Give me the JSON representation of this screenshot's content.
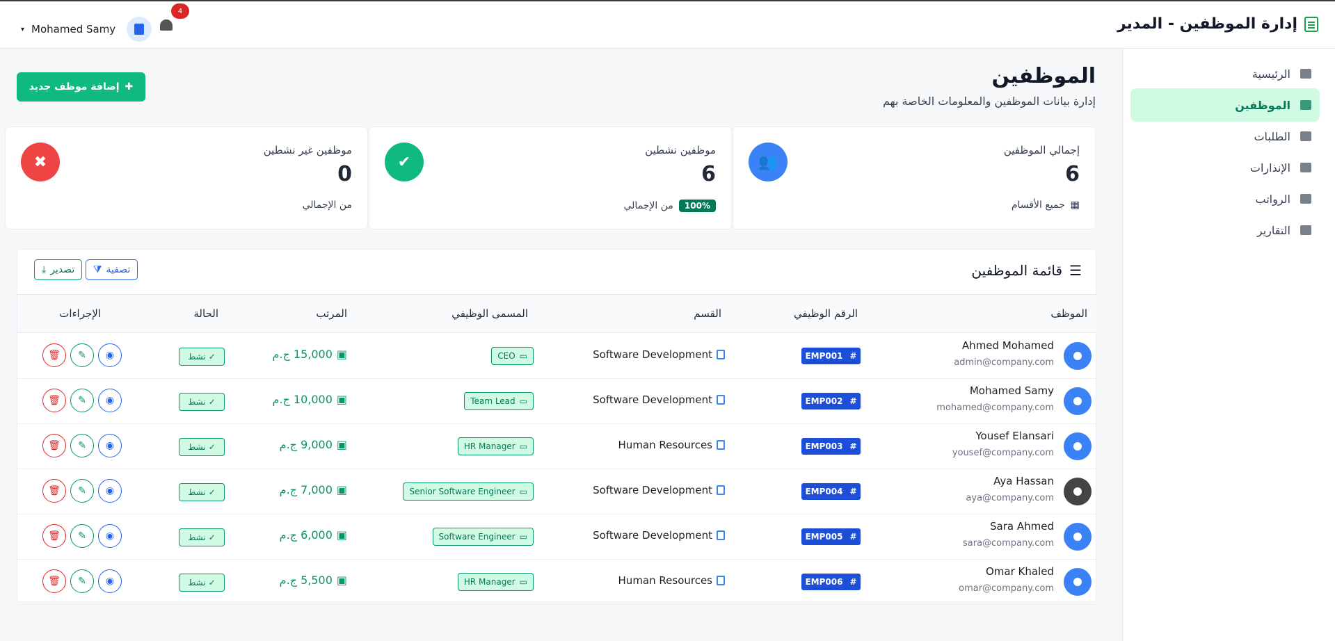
{
  "header": {
    "brand_title": "إدارة الموظفين - المدير",
    "user_name": "Mohamed Samy",
    "notification_count": "4"
  },
  "sidebar": {
    "items": [
      {
        "label": "الرئيسية",
        "icon": "dashboard-icon",
        "active": false
      },
      {
        "label": "الموظفين",
        "icon": "users-icon",
        "active": true
      },
      {
        "label": "الطلبات",
        "icon": "clipboard-icon",
        "active": false
      },
      {
        "label": "الإنذارات",
        "icon": "warning-icon",
        "active": false
      },
      {
        "label": "الرواتب",
        "icon": "money-icon",
        "active": false
      },
      {
        "label": "التقارير",
        "icon": "chart-icon",
        "active": false
      }
    ]
  },
  "page": {
    "title": "الموظفين",
    "subtitle": "إدارة بيانات الموظفين والمعلومات الخاصة بهم",
    "add_button": "إضافة موظف جديد"
  },
  "stats": [
    {
      "label": "إجمالي الموظفين",
      "value": "6",
      "footer": "جميع الأقسام",
      "color": "#3b82f6",
      "icon": "users-icon"
    },
    {
      "label": "موظفين نشطين",
      "value": "6",
      "footer": "من الإجمالي",
      "percent": "100%",
      "color": "#10b981",
      "icon": "user-check-icon"
    },
    {
      "label": "موظفين غير نشطين",
      "value": "0",
      "footer": "من الإجمالي",
      "color": "#ef4444",
      "icon": "user-x-icon"
    }
  ],
  "table": {
    "title": "قائمة الموظفين",
    "filter_label": "تصفية",
    "export_label": "تصدير",
    "columns": [
      "الموظف",
      "الرقم الوظيفي",
      "القسم",
      "المسمى الوظيفي",
      "المرتب",
      "الحالة",
      "الإجراءات"
    ],
    "rows": [
      {
        "name": "Ahmed Mohamed",
        "email": "admin@company.com",
        "id": "EMP001",
        "dept": "Software Development",
        "job": "CEO",
        "salary": "15,000 ج.م",
        "status": "نشط",
        "photo": false
      },
      {
        "name": "Mohamed Samy",
        "email": "mohamed@company.com",
        "id": "EMP002",
        "dept": "Software Development",
        "job": "Team Lead",
        "salary": "10,000 ج.م",
        "status": "نشط",
        "photo": false
      },
      {
        "name": "Yousef Elansari",
        "email": "yousef@company.com",
        "id": "EMP003",
        "dept": "Human Resources",
        "job": "HR Manager",
        "salary": "9,000 ج.م",
        "status": "نشط",
        "photo": false
      },
      {
        "name": "Aya Hassan",
        "email": "aya@company.com",
        "id": "EMP004",
        "dept": "Software Development",
        "job": "Senior Software Engineer",
        "salary": "7,000 ج.م",
        "status": "نشط",
        "photo": true
      },
      {
        "name": "Sara Ahmed",
        "email": "sara@company.com",
        "id": "EMP005",
        "dept": "Software Development",
        "job": "Software Engineer",
        "salary": "6,000 ج.م",
        "status": "نشط",
        "photo": false
      },
      {
        "name": "Omar Khaled",
        "email": "omar@company.com",
        "id": "EMP006",
        "dept": "Human Resources",
        "job": "HR Manager",
        "salary": "5,500 ج.م",
        "status": "نشط",
        "photo": false
      }
    ]
  }
}
